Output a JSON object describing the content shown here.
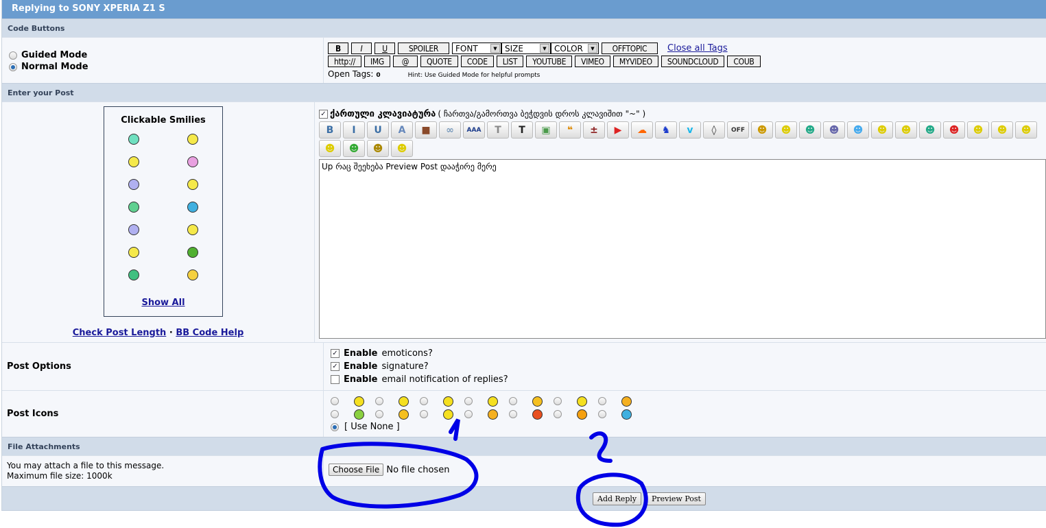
{
  "header": {
    "title": "Replying to SONY XPERIA Z1 S"
  },
  "sections": {
    "code_buttons": "Code Buttons",
    "enter_post": "Enter your Post",
    "file_attachments": "File Attachments"
  },
  "modes": {
    "guided": "Guided Mode",
    "normal": "Normal Mode",
    "selected": "normal"
  },
  "code_toolbar": {
    "row1": [
      "B",
      "I",
      "U",
      "SPOILER"
    ],
    "selects": [
      "FONT",
      "SIZE",
      "COLOR"
    ],
    "offtopic": "OFFTOPIC",
    "close_tags": "Close all Tags",
    "row2": [
      "http://",
      "IMG",
      "@",
      "QUOTE",
      "CODE",
      "LIST",
      "YOUTUBE",
      "VIMEO",
      "MYVIDEO",
      "SOUNDCLOUD",
      "COUB"
    ],
    "open_tags_label": "Open Tags:",
    "open_tags_count": "0",
    "hint": "Hint: Use Guided Mode for helpful prompts"
  },
  "smilies": {
    "title": "Clickable Smilies",
    "show_all": "Show All",
    "colors": [
      "#6fe0c0",
      "#f5e94a",
      "#f5e94a",
      "#e8a0e0",
      "#b0b0f0",
      "#f5e94a",
      "#60d090",
      "#40b0e0",
      "#b0b0f0",
      "#f5e94a",
      "#f5e94a",
      "#50b030",
      "#40c080",
      "#f5d040"
    ]
  },
  "links": {
    "check_length": "Check Post Length",
    "separator": "·",
    "bb_help": "BB Code Help"
  },
  "georgian_keyboard": {
    "label": "ქართული კლავიატურა",
    "hint": "( ჩართვა/გამორთვა ბეჭდვის დროს კლავიშით \"~\" )",
    "checked": true
  },
  "editor_icons": [
    {
      "name": "bold",
      "glyph": "B",
      "color": "#3a6ea5"
    },
    {
      "name": "italic",
      "glyph": "I",
      "color": "#3a6ea5"
    },
    {
      "name": "underline",
      "glyph": "U",
      "color": "#3a6ea5"
    },
    {
      "name": "strike",
      "glyph": "A",
      "color": "#6688bb"
    },
    {
      "name": "photo",
      "glyph": "■",
      "color": "#8a4a2a"
    },
    {
      "name": "link",
      "glyph": "∞",
      "color": "#7799bb"
    },
    {
      "name": "font-size",
      "glyph": "AAA",
      "color": "#1a3a8a"
    },
    {
      "name": "font",
      "glyph": "T",
      "color": "#888"
    },
    {
      "name": "color",
      "glyph": "T",
      "color": "#222"
    },
    {
      "name": "image",
      "glyph": "▣",
      "color": "#4a9a4a"
    },
    {
      "name": "quote",
      "glyph": "❝",
      "color": "#dd8800"
    },
    {
      "name": "offtopic-minus",
      "glyph": "±",
      "color": "#8a1a1a"
    },
    {
      "name": "youtube",
      "glyph": "▶",
      "color": "#d22"
    },
    {
      "name": "soundcloud",
      "glyph": "☁",
      "color": "#f60"
    },
    {
      "name": "myvideo",
      "glyph": "♞",
      "color": "#1a3acc"
    },
    {
      "name": "vimeo",
      "glyph": "v",
      "color": "#1ab7ea"
    },
    {
      "name": "drop",
      "glyph": "◊",
      "color": "#333"
    },
    {
      "name": "offtopic",
      "glyph": "OFF",
      "color": "#333"
    },
    {
      "name": "smiley-1",
      "glyph": "☻",
      "color": "#c90"
    },
    {
      "name": "smiley-2",
      "glyph": "☻",
      "color": "#dc0"
    },
    {
      "name": "smiley-3",
      "glyph": "☻",
      "color": "#2a8"
    },
    {
      "name": "smiley-4",
      "glyph": "☻",
      "color": "#66a"
    },
    {
      "name": "smiley-5",
      "glyph": "☻",
      "color": "#4ae"
    },
    {
      "name": "smiley-6",
      "glyph": "☻",
      "color": "#dc0"
    },
    {
      "name": "smiley-7",
      "glyph": "☻",
      "color": "#dc0"
    },
    {
      "name": "smiley-8",
      "glyph": "☻",
      "color": "#2a8"
    },
    {
      "name": "smiley-9",
      "glyph": "☻",
      "color": "#d22"
    },
    {
      "name": "smiley-10",
      "glyph": "☻",
      "color": "#dc0"
    },
    {
      "name": "smiley-11",
      "glyph": "☻",
      "color": "#dc0"
    },
    {
      "name": "smiley-12",
      "glyph": "☻",
      "color": "#dc0"
    },
    {
      "name": "smiley-13",
      "glyph": "☻",
      "color": "#dc0"
    },
    {
      "name": "smiley-14",
      "glyph": "☻",
      "color": "#3a3"
    },
    {
      "name": "smiley-15",
      "glyph": "☻",
      "color": "#a80"
    },
    {
      "name": "smiley-16",
      "glyph": "☻",
      "color": "#dc0"
    }
  ],
  "post_text": "Up რაც შეეხება Preview Post დააჭირე მერე",
  "post_options": {
    "label": "Post Options",
    "items": [
      {
        "bold": "Enable",
        "rest": "emoticons?",
        "checked": true
      },
      {
        "bold": "Enable",
        "rest": "signature?",
        "checked": true
      },
      {
        "bold": "Enable",
        "rest": "email notification of replies?",
        "checked": false
      }
    ]
  },
  "post_icons": {
    "label": "Post Icons",
    "use_none": "[ Use None ]",
    "colors": [
      "#f5e020",
      "#f5e020",
      "#f5e020",
      "#f5e020",
      "#f5c020",
      "#f5e020",
      "#f5b020",
      "#8ad040",
      "#f5c020",
      "#f5e020",
      "#f5b020",
      "#e85020",
      "#f5a010",
      "#40b0e0"
    ]
  },
  "file": {
    "line1": "You may attach a file to this message.",
    "line2": "Maximum file size: 1000k",
    "choose": "Choose File",
    "status": "No file chosen"
  },
  "actions": {
    "add_reply": "Add Reply",
    "preview": "Preview Post"
  },
  "annotations": {
    "one": "1",
    "two": "2",
    "color": "#0000e6"
  }
}
